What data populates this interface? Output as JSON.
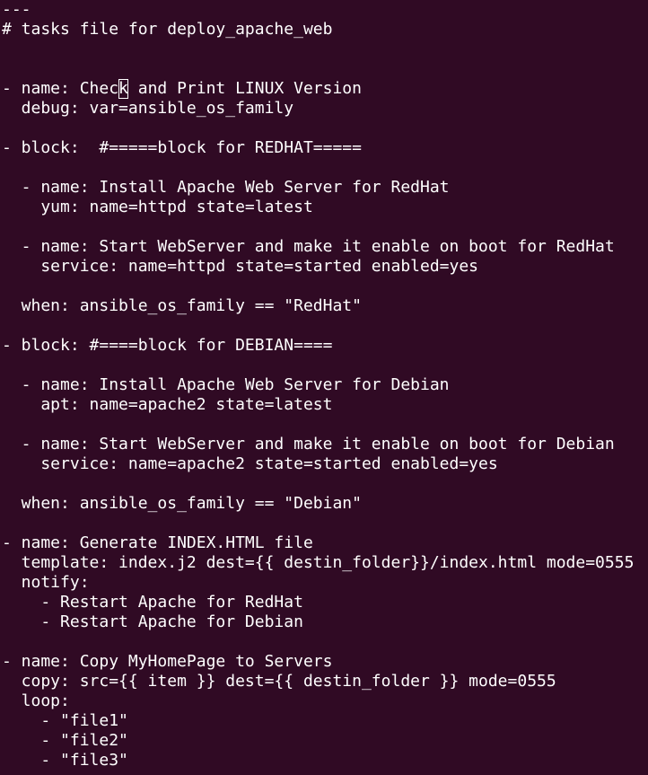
{
  "editor": {
    "lines": [
      "---",
      "# tasks file for deploy_apache_web",
      "",
      "",
      "- name: Check and Print LINUX Version",
      "  debug: var=ansible_os_family",
      "",
      "- block:  #=====block for REDHAT=====",
      "",
      "  - name: Install Apache Web Server for RedHat",
      "    yum: name=httpd state=latest",
      "",
      "  - name: Start WebServer and make it enable on boot for RedHat",
      "    service: name=httpd state=started enabled=yes",
      "",
      "  when: ansible_os_family == \"RedHat\"",
      "",
      "- block: #====block for DEBIAN====",
      "",
      "  - name: Install Apache Web Server for Debian",
      "    apt: name=apache2 state=latest",
      "",
      "  - name: Start WebServer and make it enable on boot for Debian",
      "    service: name=apache2 state=started enabled=yes",
      "",
      "  when: ansible_os_family == \"Debian\"",
      "",
      "- name: Generate INDEX.HTML file",
      "  template: index.j2 dest={{ destin_folder}}/index.html mode=0555",
      "  notify:",
      "    - Restart Apache for RedHat",
      "    - Restart Apache for Debian",
      "",
      "- name: Copy MyHomePage to Servers",
      "  copy: src={{ item }} dest={{ destin_folder }} mode=0555",
      "  loop:",
      "    - \"file1\"",
      "    - \"file2\"",
      "    - \"file3\""
    ],
    "cursor_line": 4,
    "cursor_col": 12
  },
  "colors": {
    "background": "#300a24",
    "foreground": "#ffffff"
  }
}
